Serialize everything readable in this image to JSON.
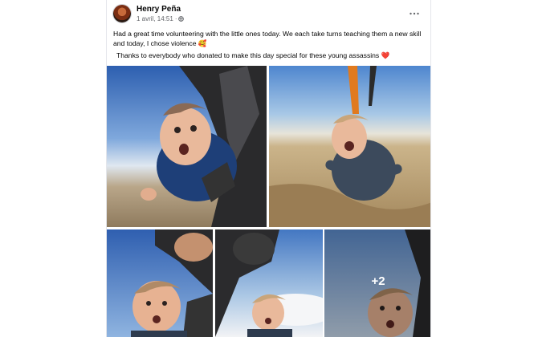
{
  "post": {
    "author": "Henry Peña",
    "timestamp": "1 avril, 14:51",
    "separator": "·",
    "audience_icon": "globe-icon",
    "more_options_icon": "ellipsis-icon",
    "text_line1": "Had a great time volunteering with the little ones today. We each take turns teaching them a new skill and today, I chose violence",
    "text_line1_emoji": "🥰",
    "text_line2": "Thanks to everybody who donated to make this day special for these young assassins",
    "text_line2_emoji": "❤️"
  },
  "media": {
    "extra_count": "+2"
  }
}
